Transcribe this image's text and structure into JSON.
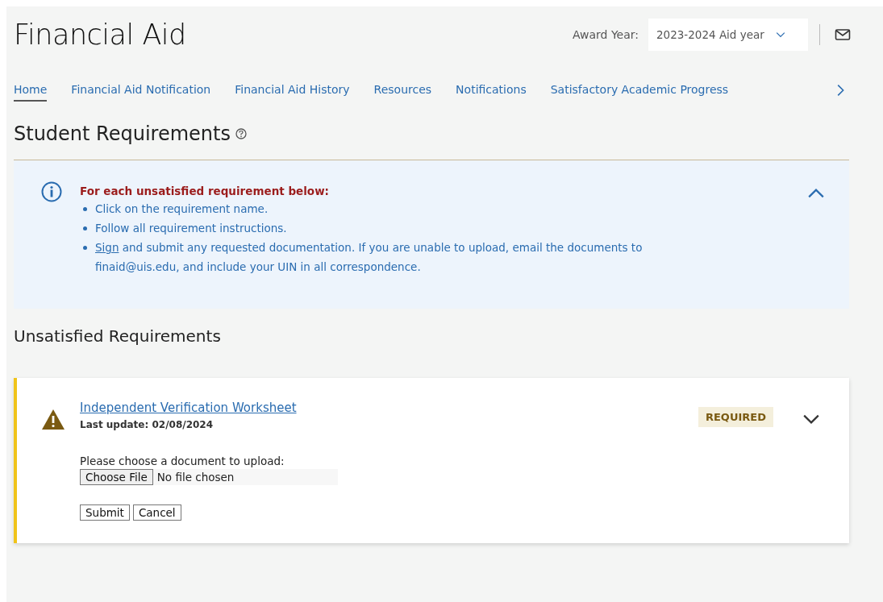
{
  "header": {
    "title": "Financial Aid",
    "award_year_label": "Award Year:",
    "award_year": "2023-2024 Aid year"
  },
  "tabs": [
    {
      "label": "Home",
      "selected": true
    },
    {
      "label": "Financial Aid Notification",
      "selected": false
    },
    {
      "label": "Financial Aid History",
      "selected": false
    },
    {
      "label": "Resources",
      "selected": false
    },
    {
      "label": "Notifications",
      "selected": false
    },
    {
      "label": "Satisfactory Academic Progress",
      "selected": false
    }
  ],
  "section_title": "Student Requirements",
  "info": {
    "heading": "For each unsatisfied requirement below:",
    "expanded": true,
    "items": [
      {
        "text": "Click on the requirement name."
      },
      {
        "text": "Follow all requirement instructions."
      },
      {
        "link": "Sign",
        "text": "and submit any requested documentation. If you are unable to upload, email the documents to finaid@uis.edu, and include your UIN in all correspondence."
      }
    ]
  },
  "unsatisfied_title": "Unsatisfied Requirements",
  "requirements": [
    {
      "name": "Independent Verification Worksheet",
      "last_update": "Last update: 02/08/2024",
      "status": "REQUIRED",
      "upload_prompt": "Please choose a document to upload:",
      "file_button": "Choose File",
      "file_status": "No file chosen",
      "buttons": [
        "Submit",
        "Cancel"
      ]
    }
  ]
}
